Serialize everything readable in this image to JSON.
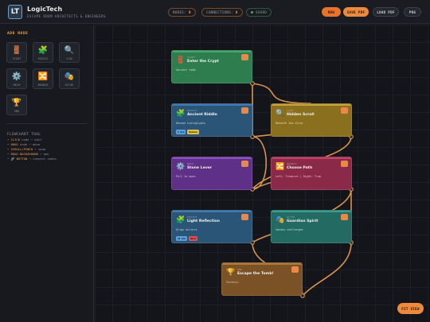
{
  "app": {
    "logo": "LT",
    "title": "LogicTech",
    "subtitle": "ESCAPE ROOM ARCHITECTS & ENGINEERS"
  },
  "stats": {
    "nodes_label": "NODES:",
    "nodes_value": "9",
    "connections_label": "CONNECTIONS:",
    "connections_value": "8",
    "saved_label": "SAVED"
  },
  "actions": {
    "new": "NEW",
    "save_pdf": "SAVE PDF",
    "load_pdf": "LOAD PDF",
    "png": "PNG"
  },
  "sidebar": {
    "title": "ADD NODE",
    "tools": [
      {
        "icon": "🚪",
        "icon_name": "door-icon",
        "label": "START"
      },
      {
        "icon": "🧩",
        "icon_name": "puzzle-icon",
        "label": "PUZZLE"
      },
      {
        "icon": "🔍",
        "icon_name": "magnifier-icon",
        "label": "CLUE"
      },
      {
        "icon": "⚙️",
        "icon_name": "gear-icon",
        "label": "MECH"
      },
      {
        "icon": "🔀",
        "icon_name": "shuffle-icon",
        "label": "BRANCH"
      },
      {
        "icon": "🎭",
        "icon_name": "masks-icon",
        "label": "ACTOR"
      },
      {
        "icon": "🏆",
        "icon_name": "trophy-icon",
        "label": "END"
      }
    ],
    "help_title": "FLOWCHART TOOL",
    "help": [
      {
        "key": "CLICK",
        "text": " node → edit"
      },
      {
        "key": "DRAG",
        "text": " node → move"
      },
      {
        "key": "SCROLL/PINCH",
        "text": " → zoom"
      },
      {
        "key": "DRAG BACKGROUND",
        "text": " → pan"
      },
      {
        "key": "🔗 BUTTON",
        "text": " → connect nodes"
      }
    ]
  },
  "nodes": [
    {
      "id": "n1",
      "icon": "🚪",
      "icon_name": "door-icon",
      "type": "START",
      "title": "Enter the Crypt",
      "desc": "Ancient tomb",
      "bg": "#2e7d4f",
      "accent": "#43a86b",
      "tags": []
    },
    {
      "id": "n2",
      "icon": "🧩",
      "icon_name": "puzzle-icon",
      "type": "PUZZLE",
      "title": "Ancient Riddle",
      "desc": "Decode hieroglyphs",
      "bg": "#2b5577",
      "accent": "#3f7bb0",
      "tags": [
        {
          "text": "5 min",
          "color": "#5aa0e0"
        },
        {
          "text": "Medium",
          "color": "#e0c040"
        }
      ]
    },
    {
      "id": "n3",
      "icon": "🔍",
      "icon_name": "magnifier-icon",
      "type": "CLUE",
      "title": "Hidden Scroll",
      "desc": "Beneath the altar",
      "bg": "#8a6f1f",
      "accent": "#c4a43a",
      "tags": []
    },
    {
      "id": "n4",
      "icon": "⚙️",
      "icon_name": "gear-icon",
      "type": "MECH",
      "title": "Stone Lever",
      "desc": "Pull to open",
      "bg": "#5e3088",
      "accent": "#8a4fc0",
      "tags": []
    },
    {
      "id": "n5",
      "icon": "🔀",
      "icon_name": "shuffle-icon",
      "type": "BRANCH",
      "title": "Choose Path",
      "desc": "Left: Treasure | Right: Trap",
      "bg": "#8a2a48",
      "accent": "#c24068",
      "tags": []
    },
    {
      "id": "n6",
      "icon": "🧩",
      "icon_name": "puzzle-icon",
      "type": "PUZZLE",
      "title": "Light Reflection",
      "desc": "Align mirrors",
      "bg": "#2b5577",
      "accent": "#3f7bb0",
      "tags": [
        {
          "text": "10 min",
          "color": "#5aa0e0"
        },
        {
          "text": "Hard",
          "color": "#e05050"
        }
      ]
    },
    {
      "id": "n7",
      "icon": "🎭",
      "icon_name": "masks-icon",
      "type": "ACTOR",
      "title": "Guardian Spirit",
      "desc": "Speaks challenges",
      "bg": "#236a62",
      "accent": "#35a093",
      "tags": []
    },
    {
      "id": "n8",
      "icon": "🏆",
      "icon_name": "trophy-icon",
      "type": "END",
      "title": "Escape the Tomb!",
      "desc": "Victory!",
      "bg": "#7a5226",
      "accent": "#b07a3a",
      "tags": []
    }
  ],
  "colors": {
    "accent": "#e8732a",
    "wire": "#f0a050"
  },
  "fit_view": "FIT VIEW"
}
